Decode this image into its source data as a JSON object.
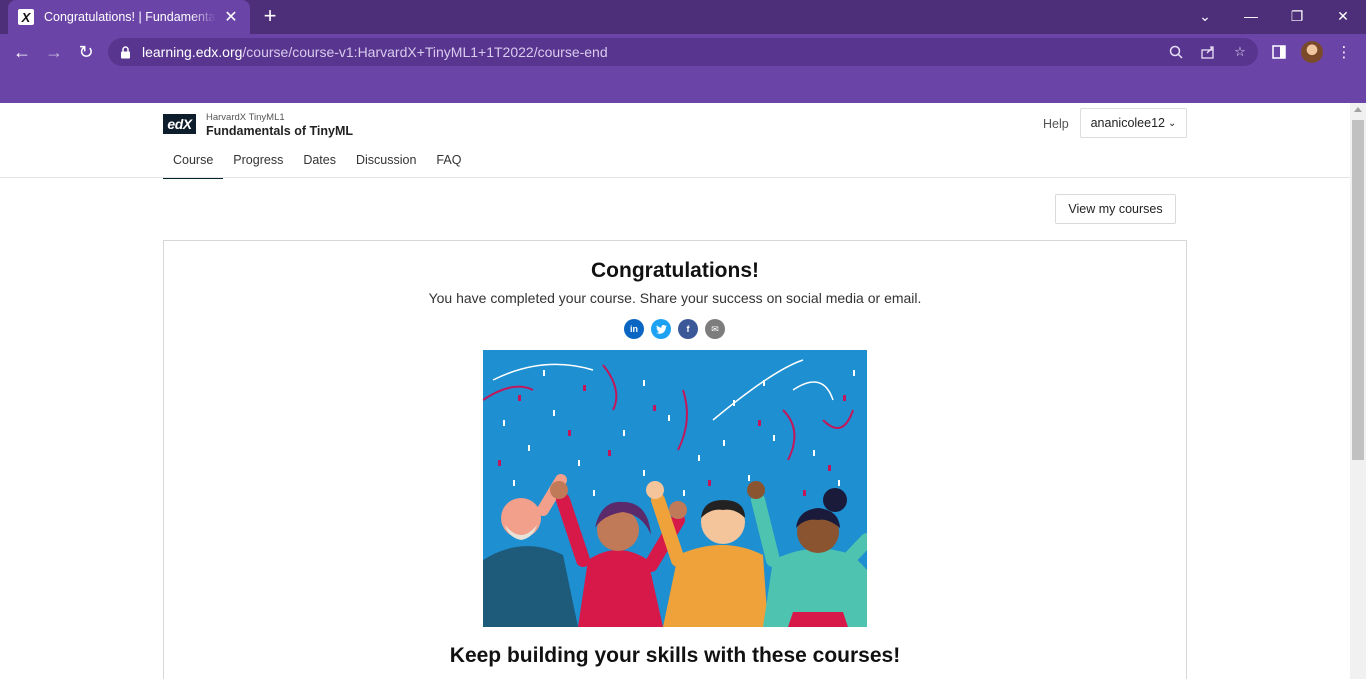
{
  "browser": {
    "tab_title": "Congratulations! | Fundamentals",
    "tab_favicon": "X",
    "url_host": "learning.edx.org",
    "url_path": "/course/course-v1:HarvardX+TinyML1+1T2022/course-end",
    "icons": [
      "back-icon",
      "forward-icon",
      "reload-icon",
      "lock-icon",
      "zoom-icon",
      "share-icon",
      "star-icon",
      "sidepanel-icon",
      "profile-avatar",
      "kebab-menu-icon",
      "minimize-icon",
      "restore-icon",
      "close-icon",
      "chevron-down-icon",
      "new-tab-icon"
    ]
  },
  "header": {
    "logo": "edX",
    "course_org": "HarvardX TinyML1",
    "course_title": "Fundamentals of TinyML",
    "help": "Help",
    "username": "ananicolee12"
  },
  "nav": {
    "tabs": [
      {
        "label": "Course",
        "active": true
      },
      {
        "label": "Progress",
        "active": false
      },
      {
        "label": "Dates",
        "active": false
      },
      {
        "label": "Discussion",
        "active": false
      },
      {
        "label": "FAQ",
        "active": false
      }
    ]
  },
  "main": {
    "view_courses": "View my courses",
    "heading": "Congratulations!",
    "subtext": "You have completed your course. Share your success on social media or email.",
    "share": [
      {
        "name": "linkedin-share-button",
        "glyph": "in",
        "color": "#0a66c2"
      },
      {
        "name": "twitter-share-button",
        "glyph": "t",
        "color": "#1da1f2"
      },
      {
        "name": "facebook-share-button",
        "glyph": "f",
        "color": "#3b5998"
      },
      {
        "name": "email-share-button",
        "glyph": "✉",
        "color": "#7d7d7d"
      }
    ],
    "next_heading": "Keep building your skills with these courses!"
  },
  "colors": {
    "chrome_dark": "#4d2e78",
    "chrome": "#6b44a8",
    "active_tab_underline": "#00262b",
    "celebration_bg": "#1e8fd0"
  }
}
